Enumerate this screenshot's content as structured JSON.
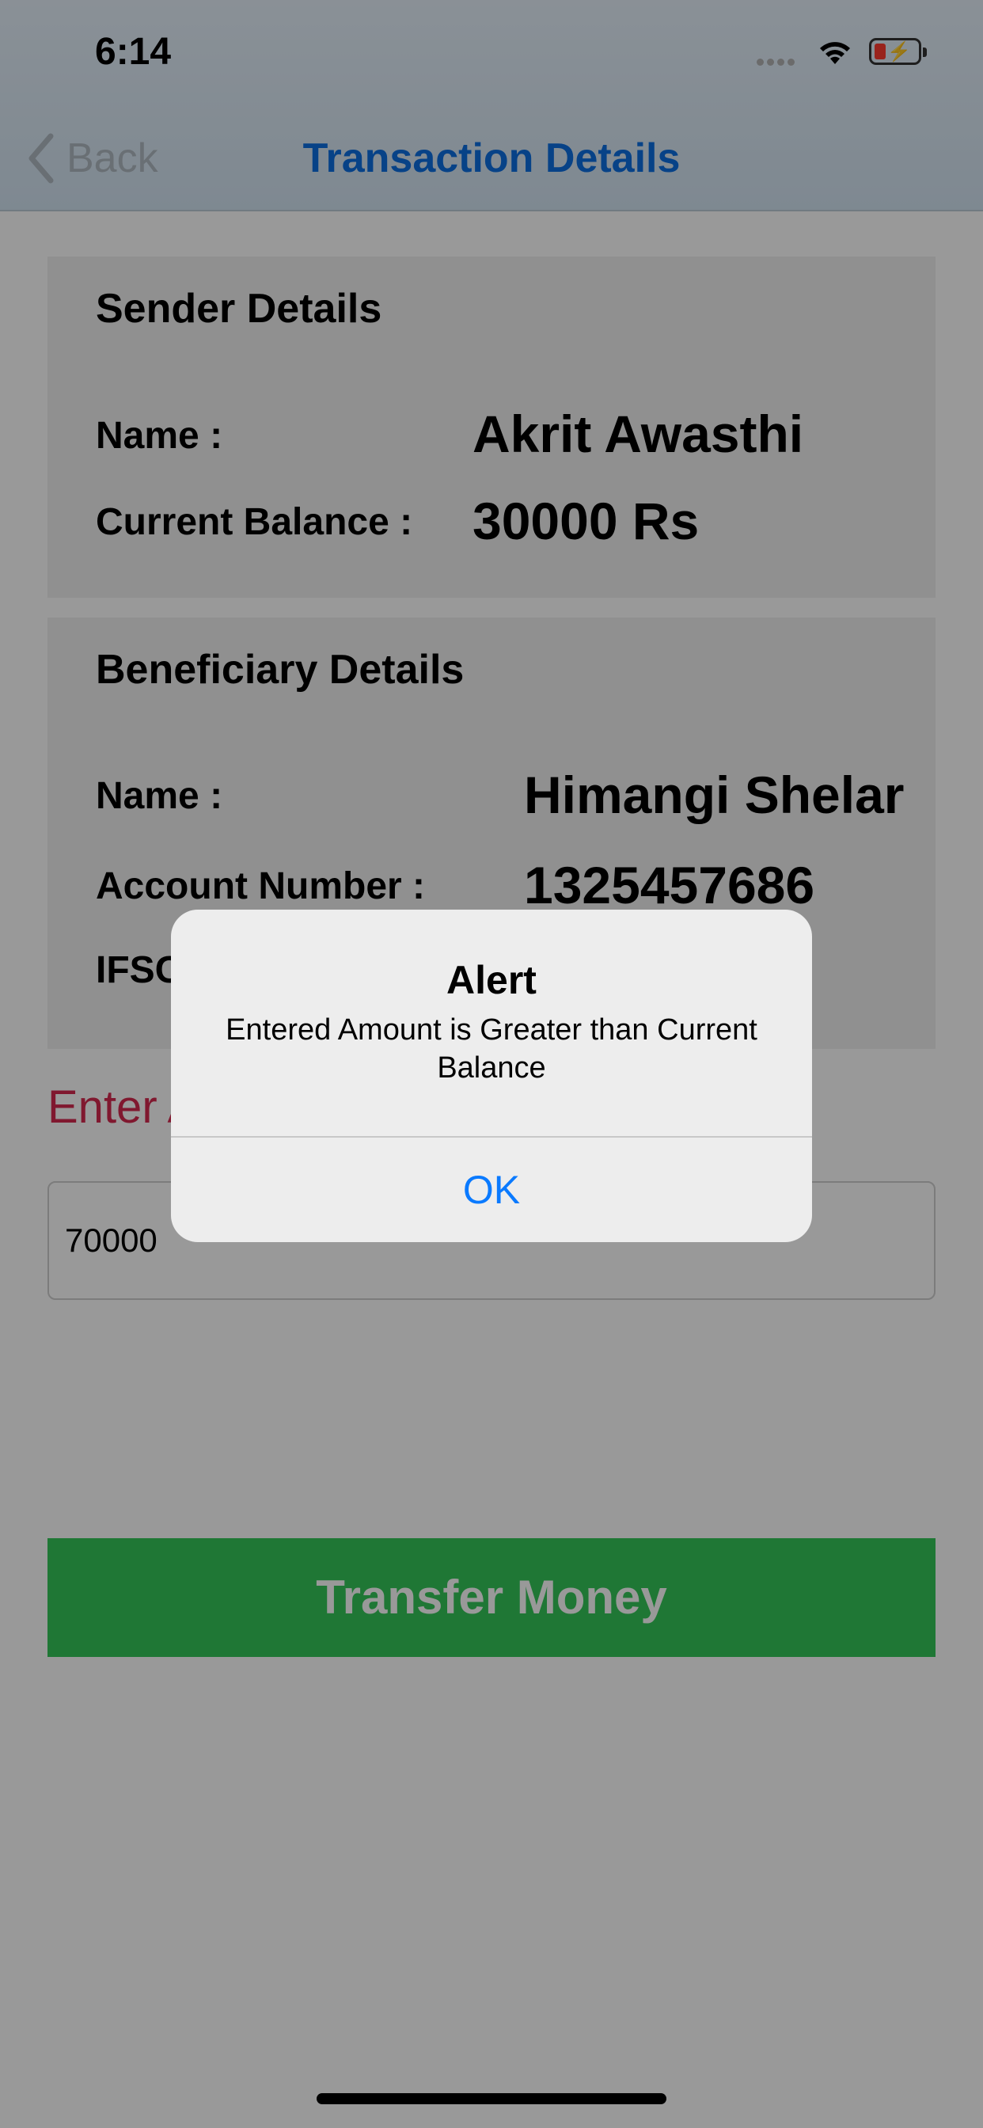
{
  "status_bar": {
    "time": "6:14"
  },
  "nav": {
    "back_label": "Back",
    "title": "Transaction Details"
  },
  "sender": {
    "title": "Sender Details",
    "name_label": "Name :",
    "name_value": "Akrit Awasthi",
    "balance_label": "Current Balance :",
    "balance_value": "30000 Rs"
  },
  "beneficiary": {
    "title": "Beneficiary Details",
    "name_label": "Name :",
    "name_value": "Himangi Shelar",
    "account_label": "Account Number :",
    "account_value": "1325457686",
    "ifsc_label": "IFSC"
  },
  "amount": {
    "label": "Enter A",
    "value": "70000"
  },
  "transfer_button": "Transfer Money",
  "alert": {
    "title": "Alert",
    "message": "Entered Amount is Greater than Current Balance",
    "ok": "OK"
  }
}
